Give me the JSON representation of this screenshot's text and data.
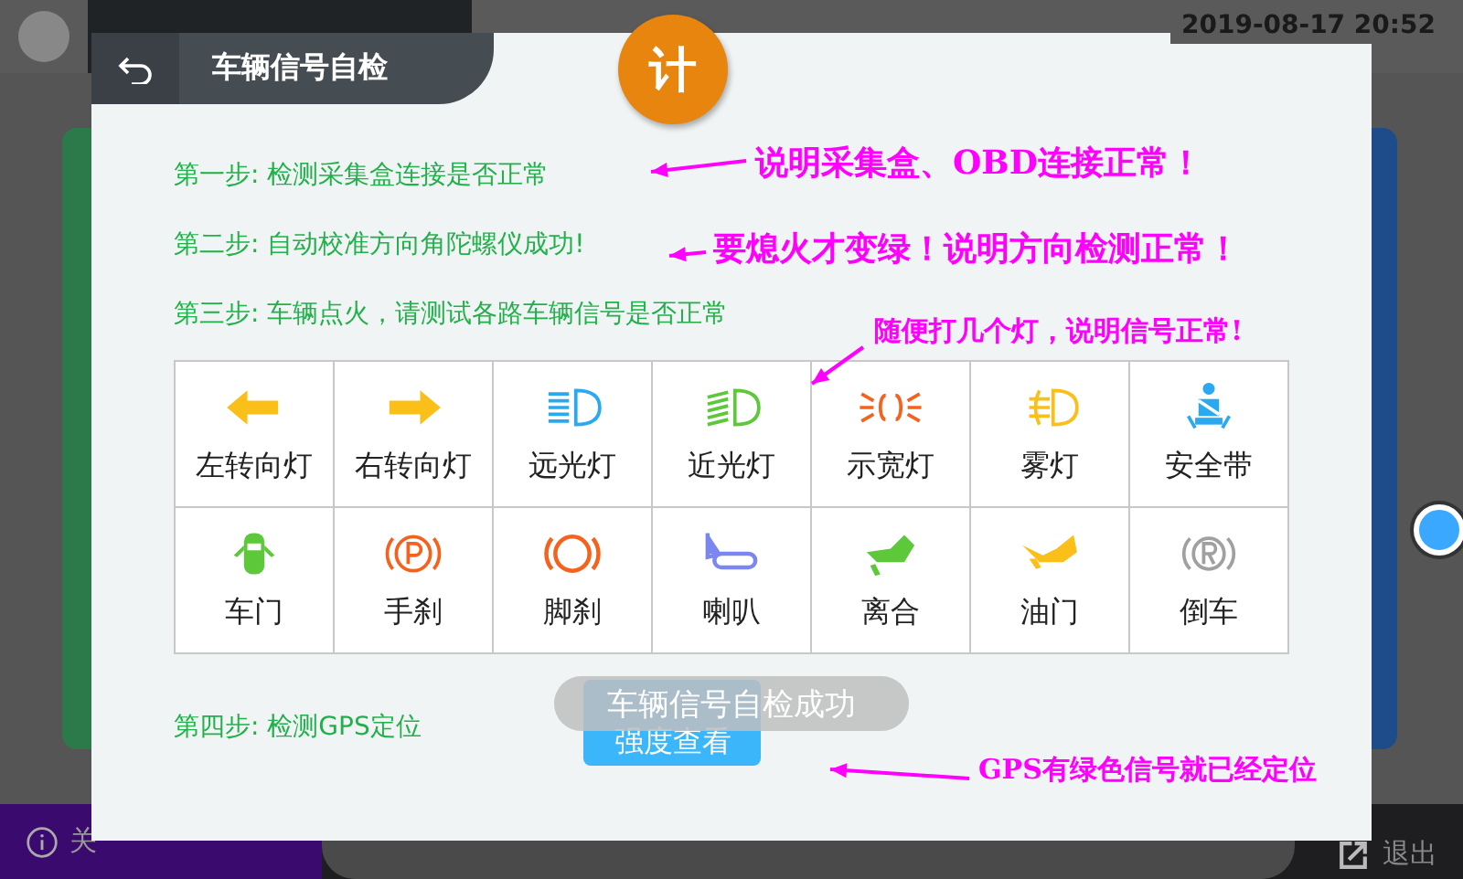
{
  "app": {
    "time": "2019-08-17 20:52",
    "about": "关",
    "exit": "退出"
  },
  "dialog": {
    "title": "车辆信号自检",
    "badge": "计",
    "steps": [
      {
        "text": "第一步: 检测采集盒连接是否正常"
      },
      {
        "text": "第二步: 自动校准方向角陀螺仪成功!"
      },
      {
        "text": "第三步: 车辆点火，请测试各路车辆信号是否正常"
      }
    ],
    "signals": [
      {
        "label": "左转向灯",
        "kind": "left-arrow",
        "color": "#fbbf1a"
      },
      {
        "label": "右转向灯",
        "kind": "right-arrow",
        "color": "#fbbf1a"
      },
      {
        "label": "远光灯",
        "kind": "high-beam",
        "color": "#2aa8f0"
      },
      {
        "label": "近光灯",
        "kind": "low-beam",
        "color": "#5cc83a"
      },
      {
        "label": "示宽灯",
        "kind": "side-light",
        "color": "#f5621e"
      },
      {
        "label": "雾灯",
        "kind": "fog-light",
        "color": "#fbbf1a"
      },
      {
        "label": "安全带",
        "kind": "seatbelt",
        "color": "#2aa8f0"
      },
      {
        "label": "车门",
        "kind": "door",
        "color": "#5cc83a"
      },
      {
        "label": "手刹",
        "kind": "handbrake",
        "color": "#f5621e"
      },
      {
        "label": "脚刹",
        "kind": "footbrake",
        "color": "#f5621e"
      },
      {
        "label": "喇叭",
        "kind": "horn",
        "color": "#7b86f0"
      },
      {
        "label": "离合",
        "kind": "clutch",
        "color": "#5cc83a"
      },
      {
        "label": "油门",
        "kind": "throttle",
        "color": "#fbbf1a"
      },
      {
        "label": "倒车",
        "kind": "reverse",
        "color": "#a0a0a0"
      }
    ],
    "step4": "第四步: 检测GPS定位",
    "button": "强度查看",
    "toast": "车辆信号自检成功"
  },
  "annotations": [
    {
      "text": "说明采集盒、OBD连接正常！"
    },
    {
      "text": "要熄火才变绿！说明方向检测正常！"
    },
    {
      "text": "随便打几个灯，说明信号正常!"
    },
    {
      "text": "GPS有绿色信号就已经定位"
    }
  ]
}
